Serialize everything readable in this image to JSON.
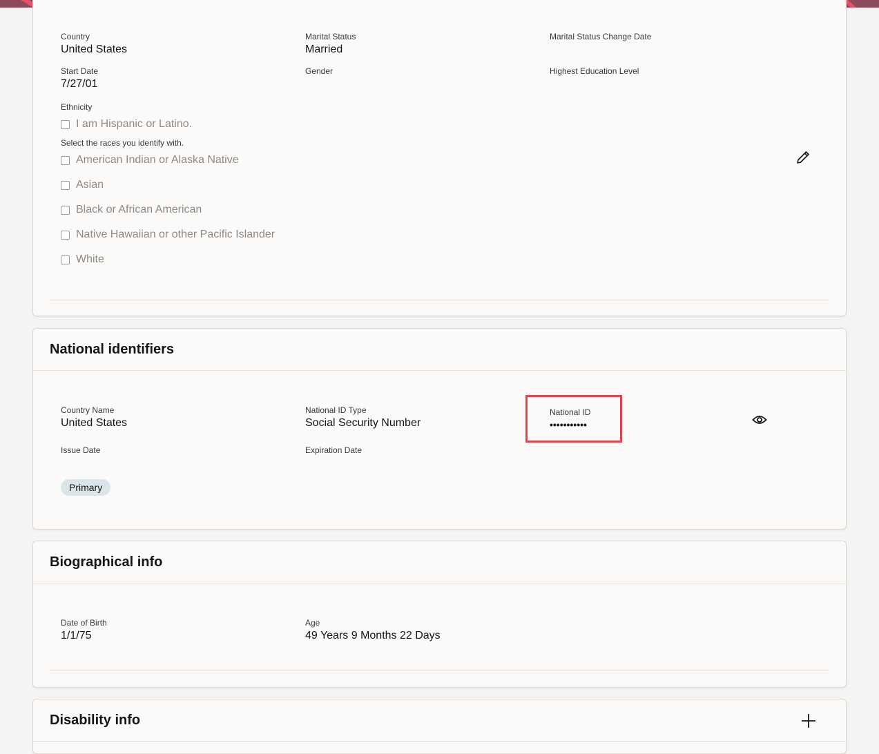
{
  "personal": {
    "country_label": "Country",
    "country_value": "United States",
    "marital_status_label": "Marital Status",
    "marital_status_value": "Married",
    "marital_change_date_label": "Marital Status Change Date",
    "start_date_label": "Start Date",
    "start_date_value": "7/27/01",
    "gender_label": "Gender",
    "education_label": "Highest Education Level",
    "ethnicity_label": "Ethnicity",
    "hispanic_option": "I am Hispanic or Latino.",
    "races_label": "Select the races you identify with.",
    "races": [
      "American Indian or Alaska Native",
      "Asian",
      "Black or African American",
      "Native Hawaiian or other Pacific Islander",
      "White"
    ],
    "edit_icon": "pencil-icon"
  },
  "national_identifiers": {
    "title": "National identifiers",
    "country_name_label": "Country Name",
    "country_name_value": "United States",
    "id_type_label": "National ID Type",
    "id_type_value": "Social Security Number",
    "national_id_label": "National ID",
    "national_id_value": "•••••••••••",
    "issue_date_label": "Issue Date",
    "expiration_date_label": "Expiration Date",
    "primary_badge": "Primary",
    "reveal_icon": "eye-icon",
    "highlight_color": "#e5444f"
  },
  "biographical": {
    "title": "Biographical info",
    "dob_label": "Date of Birth",
    "dob_value": "1/1/75",
    "age_label": "Age",
    "age_value": "49 Years 9 Months 22 Days"
  },
  "disability": {
    "title": "Disability info",
    "add_icon": "plus-icon"
  }
}
